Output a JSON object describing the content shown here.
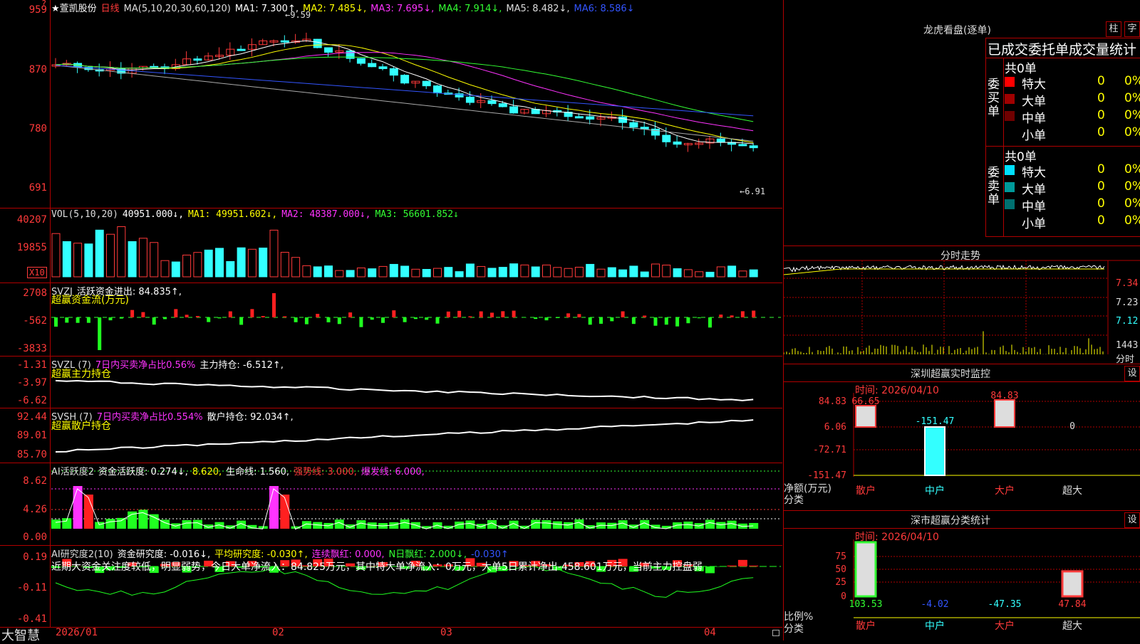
{
  "main": {
    "stock": "★萱凯股份",
    "period": "日线",
    "ma_title": "MA(5,10,20,30,60,120)",
    "ma1": "MA1: 7.300↑,",
    "ma2": "MA2: 7.485↓,",
    "ma3": "MA3: 7.695↓,",
    "ma4": "MA4: 7.914↓,",
    "ma5": "MA5: 8.482↓,",
    "ma6": "MA6: 8.586↓",
    "high_label": "←9.59",
    "low_label": "←6.91",
    "y_labels": [
      "959",
      "870",
      "780",
      "691"
    ],
    "top_marker": "?"
  },
  "vol": {
    "title": "VOL(5,10,20)",
    "v": "40951.000↓,",
    "ma1": "MA1: 49951.602↓,",
    "ma2": "MA2: 48387.000↓,",
    "ma3": "MA3: 56601.852↓",
    "y_labels": [
      "40207",
      "19855"
    ],
    "unit": "X10"
  },
  "svzj": {
    "title": "SVZJ",
    "value": "活跃资金进出: 84.835↑,",
    "sub": "超赢资金流(万元)",
    "y_labels": [
      "2708",
      "-562",
      "-3833"
    ]
  },
  "svzl": {
    "title": "SVZL (7)",
    "v1": "7日内买卖净占比0.56%",
    "v2": "主力持仓: -6.512↑,",
    "sub": "超赢主力持仓",
    "y_labels": [
      "-1.31",
      "-3.97",
      "-6.62"
    ]
  },
  "svsh": {
    "title": "SVSH (7)",
    "v1": "7日内买卖净占比0.554%",
    "v2": "散户持仓: 92.034↑,",
    "sub": "超赢散户持仓",
    "y_labels": [
      "92.44",
      "89.01",
      "85.70"
    ]
  },
  "ai1": {
    "title": "AI活跃度2",
    "v1": "资金活跃度: 0.274↓,",
    "v2": "8.620,",
    "v3": "生命线: 1.560,",
    "v4": "强势线: 3.000,",
    "v5": "爆发线: 6.000,",
    "y_labels": [
      "8.62",
      "4.26",
      "0.00"
    ]
  },
  "ai2": {
    "title": "AI研究度2(10)",
    "v1": "资金研究度: -0.016↓,",
    "v2": "平均研究度: -0.030↑,",
    "v3": "连续飘红: 0.000,",
    "v4": "N日飘红: 2.000↓,",
    "v5": "-0.030↑",
    "note": "近期大资金关注度较低，明显弱势，今日大单净流入：84.825万元，其中特大单净流入：0万元，大单5日累计净出-458.601万元，当前主力控盘弱",
    "y_labels": [
      "0.19",
      "-0.11",
      "-0.41"
    ]
  },
  "bottom": {
    "brand": "大智慧",
    "dates": [
      "2026/01",
      "02",
      "03",
      "04"
    ]
  },
  "longhu": {
    "title": "龙虎看盘(逐单)",
    "btn1": "柱",
    "btn2": "字",
    "header": "已成交委托单成交量统计",
    "buy_label": "委买单",
    "sell_label": "委卖单",
    "buy_total": "共0单",
    "sell_total": "共0单",
    "buy_rows": [
      {
        "name": "特大",
        "count": "0",
        "pct": "0%",
        "color": "#ff0000"
      },
      {
        "name": "大单",
        "count": "0",
        "pct": "0%",
        "color": "#a00000"
      },
      {
        "name": "中单",
        "count": "0",
        "pct": "0%",
        "color": "#700000"
      },
      {
        "name": "小单",
        "count": "0",
        "pct": "0%",
        "color": "#000000"
      }
    ],
    "sell_rows": [
      {
        "name": "特大",
        "count": "0",
        "pct": "0%",
        "color": "#00e0ff"
      },
      {
        "name": "大单",
        "count": "0",
        "pct": "0%",
        "color": "#009a9a"
      },
      {
        "name": "中单",
        "count": "0",
        "pct": "0%",
        "color": "#007070"
      },
      {
        "name": "小单",
        "count": "0",
        "pct": "0%",
        "color": "#000000"
      }
    ]
  },
  "intraday": {
    "title": "分时走势",
    "y_labels": [
      "7.34",
      "7.23",
      "7.12"
    ],
    "vol_label": "1443",
    "sub": "分时"
  },
  "sz_monitor": {
    "title": "深圳超赢实时监控",
    "btn": "设",
    "time": "时间: 2026/04/10",
    "y_labels": [
      "84.83",
      "6.06",
      "-72.71",
      "-151.47"
    ],
    "unit": "净额(万元)",
    "axis_label": "分类",
    "categories": [
      "散户",
      "中户",
      "大户",
      "超大"
    ],
    "values": [
      66.65,
      -151.47,
      84.83,
      0
    ],
    "value_labels": [
      "66.65",
      "-151.47",
      "84.83",
      "0"
    ]
  },
  "sz_class": {
    "title": "深市超赢分类统计",
    "btn": "设",
    "time": "时间: 2026/04/10",
    "y_labels": [
      "75",
      "50",
      "25",
      "0"
    ],
    "unit": "比例%",
    "axis_label": "分类",
    "categories": [
      "散户",
      "中户",
      "大户",
      "超大"
    ],
    "values": [
      103.53,
      -4.02,
      -47.35,
      47.84
    ],
    "value_labels": [
      "103.53",
      "-4.02",
      "-47.35",
      "47.84"
    ]
  }
}
